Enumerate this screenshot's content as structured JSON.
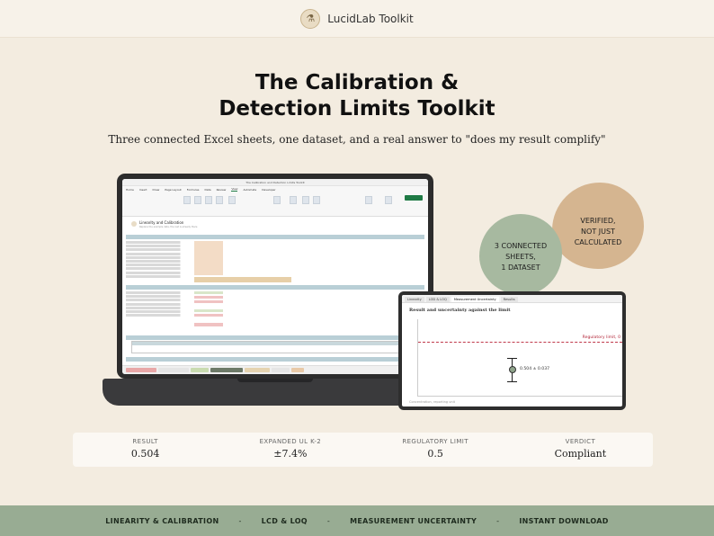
{
  "brand": {
    "name": "LucidLab Toolkit",
    "logo_icon": "flask-icon"
  },
  "hero": {
    "title_line1": "The Calibration &",
    "title_line2": "Detection Limits Toolkit",
    "subtitle": "Three connected Excel sheets, one dataset, and a real answer to \"does my result complify\""
  },
  "badges": {
    "tan": [
      "VERIFIED,",
      "NOT JUST",
      "CALCULATED"
    ],
    "green": [
      "3 CONNECTED",
      "SHEETS,",
      "1 DATASET"
    ]
  },
  "laptop": {
    "window_title": "The Calibration and Detection Limits Toolkit",
    "menu": [
      "Home",
      "Insert",
      "Draw",
      "Page Layout",
      "Formulas",
      "Data",
      "Review",
      "View",
      "Automate",
      "Developer"
    ],
    "active_menu": "View",
    "sheet_title": "Linearity and Calibration",
    "sheet_subtitle": "Replace the example data, the rest is already there"
  },
  "tablet": {
    "tabs": [
      "Linearity",
      "LOD & LOQ",
      "Measurement Uncertainty",
      "Results"
    ],
    "active_tab": "Measurement Uncertainty",
    "chart_title": "Result and uncertainty against the limit",
    "regulatory_label": "Regulatory limit, 0",
    "point_label": "0.504 ± 0.037",
    "x_label": "Concentration, reporting unit"
  },
  "chart_data": {
    "type": "scatter",
    "title": "Result and uncertainty against the limit",
    "xlabel": "Concentration, reporting unit",
    "points": [
      {
        "y": 0.504,
        "error": 0.037,
        "label": "0.504 ± 0.037"
      }
    ],
    "reference_line": {
      "label": "Regulatory limit, 0",
      "value": 0.5
    }
  },
  "stats": [
    {
      "label": "RESULT",
      "value": "0.504"
    },
    {
      "label": "EXPANDED UL K-2",
      "value": "±7.4%"
    },
    {
      "label": "REGULATORY LIMIT",
      "value": "0.5"
    },
    {
      "label": "VERDICT",
      "value": "Compliant"
    }
  ],
  "footer": {
    "items": [
      "LINEARITY & CALIBRATION",
      "LCD & LOQ",
      "MEASUREMENT UNCERTAINTY",
      "INSTANT DOWNLOAD"
    ],
    "separator": "-"
  },
  "colors": {
    "background": "#f3ece0",
    "accent_green": "#98ac93",
    "accent_tan": "#d5b590",
    "limit_red": "#c0394b"
  }
}
